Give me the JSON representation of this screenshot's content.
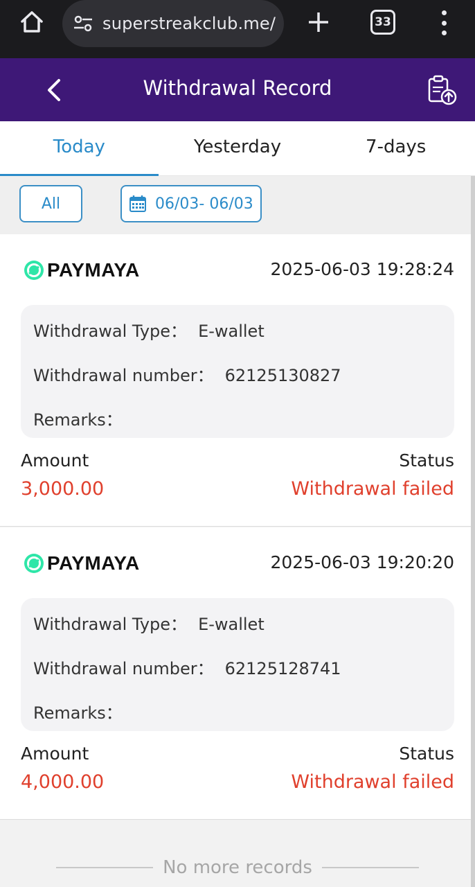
{
  "browser": {
    "url": "superstreakclub.me/m",
    "tab_count": "33"
  },
  "header": {
    "title": "Withdrawal Record"
  },
  "tabs": [
    {
      "label": "Today",
      "active": true
    },
    {
      "label": "Yesterday",
      "active": false
    },
    {
      "label": "7-days",
      "active": false
    }
  ],
  "filters": {
    "all_label": "All",
    "date_range": "06/03- 06/03"
  },
  "records": [
    {
      "method": "PAYMAYA",
      "datetime": "2025-06-03 19:28:24",
      "type_label": "Withdrawal Type：",
      "type_value": "E-wallet",
      "number_label": "Withdrawal number：",
      "number_value": "62125130827",
      "remarks_label": "Remarks：",
      "amount_label": "Amount",
      "amount_value": "3,000.00",
      "status_label": "Status",
      "status_value": "Withdrawal failed"
    },
    {
      "method": "PAYMAYA",
      "datetime": "2025-06-03 19:20:20",
      "type_label": "Withdrawal Type：",
      "type_value": "E-wallet",
      "number_label": "Withdrawal number：",
      "number_value": "62125128741",
      "remarks_label": "Remarks：",
      "amount_label": "Amount",
      "amount_value": "4,000.00",
      "status_label": "Status",
      "status_value": "Withdrawal failed"
    }
  ],
  "footer": {
    "no_more": "No more records"
  },
  "colors": {
    "header_bg": "#3e1877",
    "accent": "#2a8bc9",
    "error": "#e0402d",
    "paymaya_green": "#2ee6a8"
  }
}
